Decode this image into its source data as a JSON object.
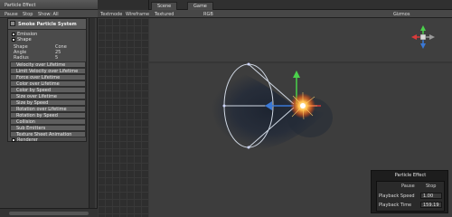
{
  "left": {
    "title": "Particle Effect",
    "toolbar": [
      "Pause",
      "Stop",
      "Show: All"
    ],
    "particle_system": {
      "title": "Smoke Particle System",
      "checks": [
        {
          "label": "Emission"
        },
        {
          "label": "Shape"
        }
      ],
      "props": [
        {
          "key": "Shape",
          "value": "Cone"
        },
        {
          "key": "Angle",
          "value": "25"
        },
        {
          "key": "Radius",
          "value": "5"
        }
      ],
      "modules": [
        "Velocity over Lifetime",
        "Limit Velocity over Lifetime",
        "Force over Lifetime",
        "Color over Lifetime",
        "Color by Speed",
        "Size over Lifetime",
        "Size by Speed",
        "Rotation over Lifetime",
        "Rotation by Speed",
        "Collision",
        "Sub Emitters",
        "Texture Sheet Animation"
      ],
      "renderer_label": "Renderer"
    }
  },
  "middle": {
    "tabs": [
      "Textmode",
      "Wireframe"
    ]
  },
  "scene": {
    "tabs": [
      "Scene",
      "Game"
    ],
    "toolbar": {
      "mode": "Textured",
      "rgb": "RGB",
      "gizmos": "Gizmos"
    }
  },
  "particle_effect": {
    "title": "Particle Effect",
    "headers": [
      "Pause",
      "Stop"
    ],
    "rows": [
      {
        "key": "Playback Speed",
        "value": "1.00"
      },
      {
        "key": "Playback Time",
        "value": "159.19"
      }
    ]
  },
  "colors": {
    "accent_blue": "#3a78d6",
    "gizmo_green": "#4bd14b",
    "gizmo_red": "#d93b3b",
    "spark": "#ff9a2a"
  },
  "icons": [
    "gizmo-icon",
    "move-handle-icon"
  ]
}
